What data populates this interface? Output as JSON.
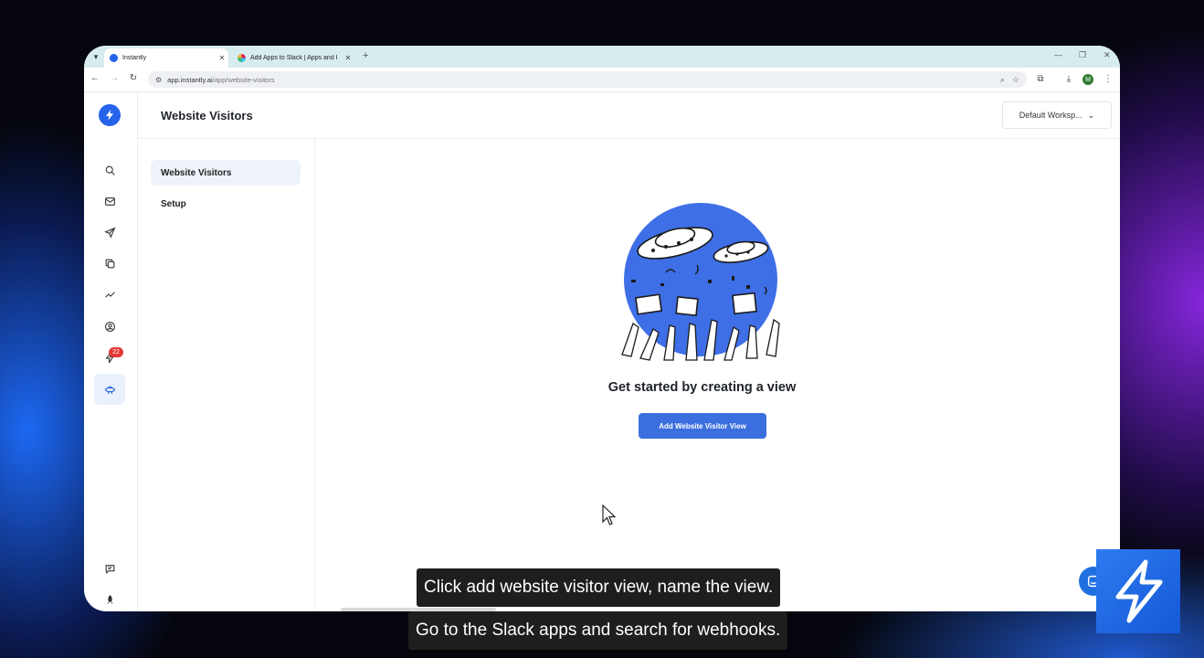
{
  "browser": {
    "tabs": [
      {
        "title": "Instantly",
        "active": true
      },
      {
        "title": "Add Apps to Slack | Apps and I",
        "active": false
      }
    ],
    "url_host": "app.instantly.ai",
    "url_path": "/app/website-visitors",
    "profile_initial": "M"
  },
  "header": {
    "title": "Website Visitors",
    "workspace": "Default Worksp..."
  },
  "sidebar": {
    "badge_count": "22",
    "avatar_initial": "M"
  },
  "subnav": {
    "items": [
      {
        "label": "Website Visitors",
        "active": true
      },
      {
        "label": "Setup",
        "active": false
      }
    ]
  },
  "main": {
    "empty_title": "Get started by creating a view",
    "cta_label": "Add Website Visitor View"
  },
  "captions": {
    "line1": "Click add website visitor view, name the view.",
    "line2": "Go to the Slack apps and search for webhooks."
  },
  "colors": {
    "brand": "#2563eb",
    "cta": "#3b6fe0",
    "badge": "#e53935"
  }
}
